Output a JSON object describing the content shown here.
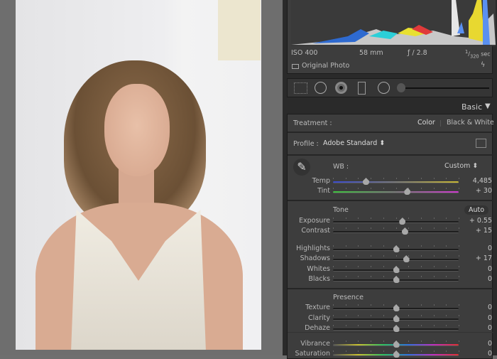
{
  "histogram": {
    "iso": "ISO 400",
    "focal": "58 mm",
    "aperture": "ƒ / 2.8",
    "shutter_num": "1",
    "shutter_den": "320",
    "shutter_unit": "sec",
    "original_photo": "Original Photo"
  },
  "toolbar": {
    "tools": [
      "crop-overlay-icon",
      "spot-removal-icon",
      "red-eye-icon",
      "graduated-filter-icon",
      "radial-filter-icon",
      "adjustment-brush-icon"
    ]
  },
  "basic": {
    "title": "Basic",
    "treatment_label": "Treatment :",
    "color": "Color",
    "bw": "Black & White",
    "profile_label": "Profile :",
    "profile_value": "Adobe Standard",
    "wb_label": "WB :",
    "wb_value": "Custom",
    "tone_label": "Tone",
    "auto": "Auto",
    "presence_label": "Presence",
    "sliders": [
      {
        "label": "Temp",
        "value": "4,485",
        "pos": 0.26,
        "track": "temp"
      },
      {
        "label": "Tint",
        "value": "+ 30",
        "pos": 0.59,
        "track": "tint"
      },
      {
        "label": "Exposure",
        "value": "+ 0.55",
        "pos": 0.55
      },
      {
        "label": "Contrast",
        "value": "+ 15",
        "pos": 0.57
      },
      {
        "label": "Highlights",
        "value": "0",
        "pos": 0.5
      },
      {
        "label": "Shadows",
        "value": "+ 17",
        "pos": 0.58
      },
      {
        "label": "Whites",
        "value": "0",
        "pos": 0.5
      },
      {
        "label": "Blacks",
        "value": "0",
        "pos": 0.5
      },
      {
        "label": "Texture",
        "value": "0",
        "pos": 0.5
      },
      {
        "label": "Clarity",
        "value": "0",
        "pos": 0.5
      },
      {
        "label": "Dehaze",
        "value": "0",
        "pos": 0.5
      },
      {
        "label": "Vibrance",
        "value": "0",
        "pos": 0.5,
        "track": "vib"
      },
      {
        "label": "Saturation",
        "value": "0",
        "pos": 0.5,
        "track": "vib"
      }
    ]
  },
  "colors": {
    "panel": "#3d3d3d",
    "accent_temp_start": "#3a4bd0",
    "accent_temp_end": "#c8b832",
    "tint_start": "#3fc43f",
    "tint_end": "#d13ad1"
  }
}
